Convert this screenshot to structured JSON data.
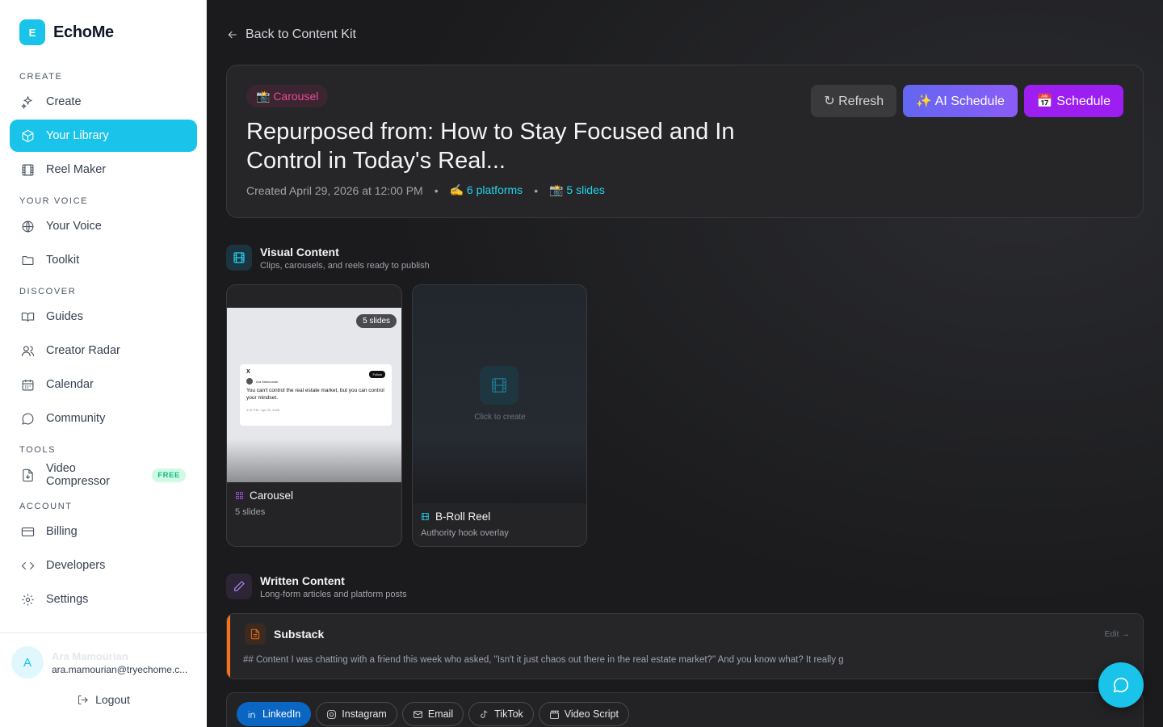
{
  "brand": {
    "logo_letter": "E",
    "name": "EchoMe",
    "accent": "#19c3ea"
  },
  "sidebar": {
    "sections": {
      "create": "CREATE",
      "your_voice": "YOUR VOICE",
      "discover": "DISCOVER",
      "tools": "TOOLS",
      "account": "ACCOUNT"
    },
    "items": {
      "create": "Create",
      "library": "Your Library",
      "reel_maker": "Reel Maker",
      "your_voice": "Your Voice",
      "toolkit": "Toolkit",
      "guides": "Guides",
      "creator_radar": "Creator Radar",
      "calendar": "Calendar",
      "community": "Community",
      "video_compressor": "Video Compressor",
      "free_badge": "FREE",
      "billing": "Billing",
      "developers": "Developers",
      "settings": "Settings"
    },
    "user": {
      "avatar_letter": "A",
      "name": "Ara Mamourian",
      "email": "ara.mamourian@tryechome.c..."
    },
    "logout": "Logout"
  },
  "main": {
    "back": "Back to Content Kit",
    "header": {
      "type_pill": "📸 Carousel",
      "title": "Repurposed from: How to Stay Focused and In Control in Today's Real...",
      "created": "Created April 29, 2026 at 12:00 PM",
      "dot": "•",
      "platforms": "✍️ 6 platforms",
      "slides": "📸 5 slides",
      "refresh": "↻ Refresh",
      "ai_schedule": "✨ AI Schedule",
      "schedule": "📅 Schedule"
    },
    "visual": {
      "title": "Visual Content",
      "subtitle": "Clips, carousels, and reels ready to publish",
      "carousel": {
        "slides_pill": "5 slides",
        "tweet_x": "X",
        "tweet_follow": "Follow",
        "tweet_name": "Ara Mamourian",
        "tweet_text": "You can't control the real estate market, but you can control your mindset.",
        "tweet_time": "4:41 PM · Apr 29, 2026",
        "name": "Carousel",
        "sub": "5 slides"
      },
      "reel": {
        "cta": "Click to create",
        "name": "B-Roll Reel",
        "sub": "Authority hook overlay"
      }
    },
    "written": {
      "title": "Written Content",
      "subtitle": "Long-form articles and platform posts",
      "substack": {
        "title": "Substack",
        "edit": "Edit →",
        "body": "## Content I was chatting with a friend this week who asked, \"Isn't it just chaos out there in the real estate market?\" And you know what? It really g"
      }
    },
    "tabs": [
      "LinkedIn",
      "Instagram",
      "Email",
      "TikTok",
      "Video Script"
    ]
  }
}
